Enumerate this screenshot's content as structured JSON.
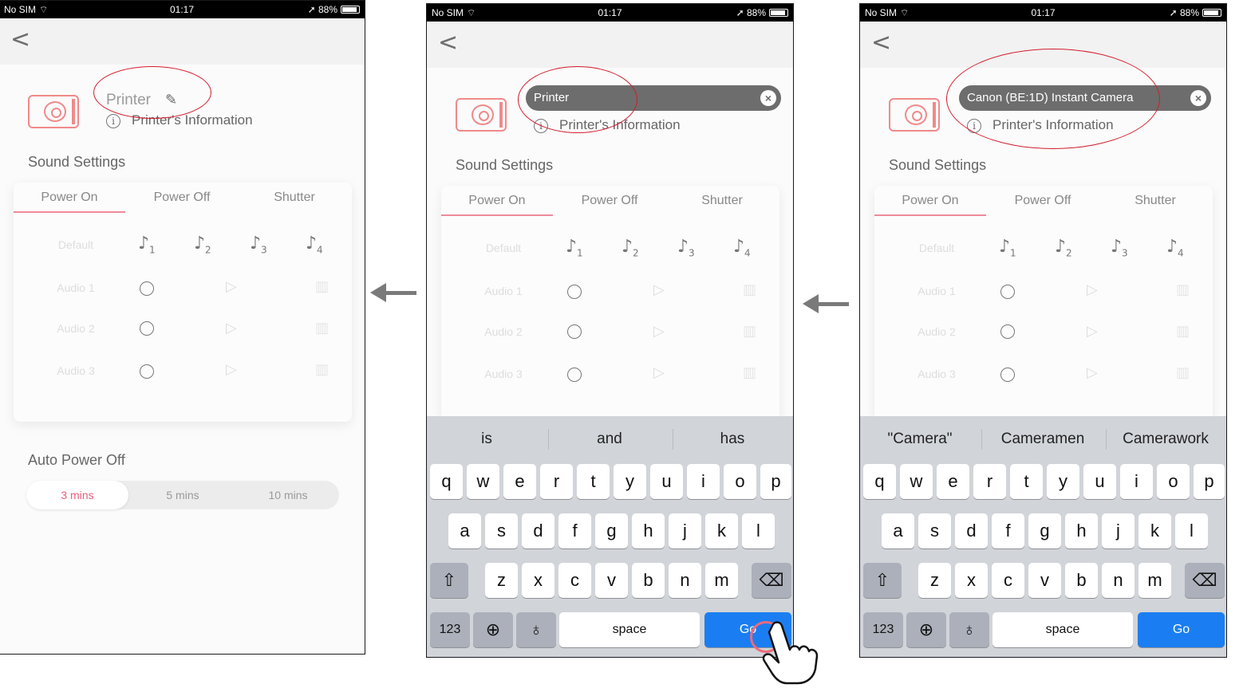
{
  "status_bar": {
    "carrier": "No SIM",
    "time": "01:17",
    "battery": "88%"
  },
  "screen1": {
    "printer_name": "Printer",
    "printer_info": "Printer's Information",
    "sound_settings": "Sound Settings",
    "tabs": [
      "Power On",
      "Power Off",
      "Shutter"
    ],
    "rows": [
      "Default",
      "Audio 1",
      "Audio 2",
      "Audio 3"
    ],
    "auto_power_off": "Auto Power Off",
    "power_options": [
      "3 mins",
      "5 mins",
      "10 mins"
    ],
    "selected_power_option": "3 mins"
  },
  "screen2": {
    "input_value": "Printer",
    "printer_info": "Printer's Information",
    "sound_settings": "Sound Settings",
    "tabs": [
      "Power On",
      "Power Off",
      "Shutter"
    ],
    "rows": [
      "Default",
      "Audio 1",
      "Audio 2",
      "Audio 3"
    ],
    "suggestions": [
      "is",
      "and",
      "has"
    ]
  },
  "screen3": {
    "input_value": "Canon (BE:1D) Instant Camera",
    "printer_info": "Printer's Information",
    "sound_settings": "Sound Settings",
    "tabs": [
      "Power On",
      "Power Off",
      "Shutter"
    ],
    "rows": [
      "Default",
      "Audio 1",
      "Audio 2",
      "Audio 3"
    ],
    "suggestions": [
      "\"Camera\"",
      "Cameramen",
      "Camerawork"
    ]
  },
  "keyboard": {
    "row1": [
      "q",
      "w",
      "e",
      "r",
      "t",
      "y",
      "u",
      "i",
      "o",
      "p"
    ],
    "row2": [
      "a",
      "s",
      "d",
      "f",
      "g",
      "h",
      "j",
      "k",
      "l"
    ],
    "row3": [
      "z",
      "x",
      "c",
      "v",
      "b",
      "n",
      "m"
    ],
    "numbers_key": "123",
    "space_key": "space",
    "go_key": "Go"
  },
  "icons": {
    "back": "chevron-left-icon",
    "edit": "pencil-icon",
    "info": "info-icon",
    "clear": "clear-icon",
    "shift": "shift-icon",
    "delete": "backspace-icon",
    "globe": "globe-icon",
    "mic": "microphone-icon",
    "note": "music-note-icon",
    "play": "play-icon",
    "trash": "trash-icon"
  },
  "colors": {
    "accent": "#ef5b7a",
    "go_key": "#1a7ef2",
    "annotation": "#d41c2c",
    "arrow": "#7a7a7a"
  }
}
